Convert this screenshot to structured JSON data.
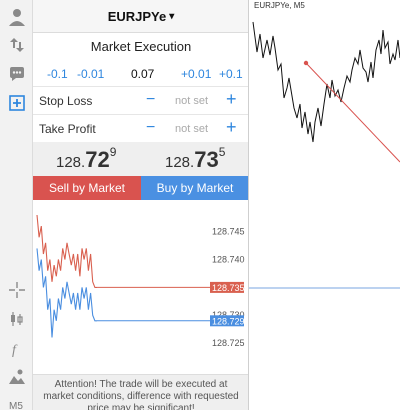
{
  "symbol": {
    "name": "EURJPYe",
    "caret": "▾"
  },
  "execution": {
    "label": "Market Execution"
  },
  "volume": {
    "steps": [
      "-0.1",
      "-0.01",
      "+0.01",
      "+0.1"
    ],
    "value": "0.07"
  },
  "stop_loss": {
    "label": "Stop Loss",
    "minus": "−",
    "value": "not set",
    "plus": "+"
  },
  "take_profit": {
    "label": "Take Profit",
    "minus": "−",
    "value": "not set",
    "plus": "+"
  },
  "quotes": {
    "bid": {
      "small": "128.",
      "big": "72",
      "sup": "9"
    },
    "ask": {
      "small": "128.",
      "big": "73",
      "sup": "5"
    }
  },
  "buttons": {
    "sell": "Sell by Market",
    "buy": "Buy by Market"
  },
  "mini_chart": {
    "ticks": [
      "128.745",
      "128.740",
      "128.735",
      "128.730",
      "128.725"
    ],
    "tick_values": [
      128.745,
      128.74,
      128.735,
      128.73,
      128.725
    ],
    "ask_label": "128.735",
    "bid_label": "128.729",
    "ask_value": 128.735,
    "bid_value": 128.729,
    "ask_series": [
      128.748,
      128.744,
      128.746,
      128.741,
      128.743,
      128.738,
      128.74,
      128.736,
      128.739,
      128.737,
      128.74,
      128.738,
      128.742,
      128.74,
      128.743,
      128.741,
      128.739,
      128.741,
      128.738,
      128.741,
      128.737,
      128.742,
      128.74,
      128.742,
      128.738,
      128.741,
      128.736,
      128.735,
      128.735
    ],
    "bid_series": [
      128.742,
      128.738,
      128.74,
      128.735,
      128.737,
      128.731,
      128.733,
      128.726,
      128.731,
      128.729,
      128.733,
      128.731,
      128.735,
      128.733,
      128.736,
      128.734,
      128.732,
      128.734,
      128.731,
      128.734,
      128.731,
      128.735,
      128.733,
      128.735,
      128.731,
      128.734,
      128.73,
      128.729,
      128.729
    ],
    "colors": {
      "ask": "#d9604f",
      "bid": "#4a8ee0"
    }
  },
  "warning": {
    "text": "Attention! The trade will be executed at market conditions, difference with requested price may be significant!"
  },
  "main_chart": {
    "title": "EURJPYe, M5"
  },
  "toolbar": {
    "icons": [
      "account-icon",
      "trade-arrows-icon",
      "chat-icon",
      "new-order-icon",
      "crosshair-icon",
      "candles-icon",
      "function-icon",
      "objects-icon"
    ],
    "timeframe": "M5"
  },
  "colors": {
    "accent": "#2e86de",
    "sell": "#d9534f",
    "buy": "#4a90e2"
  }
}
